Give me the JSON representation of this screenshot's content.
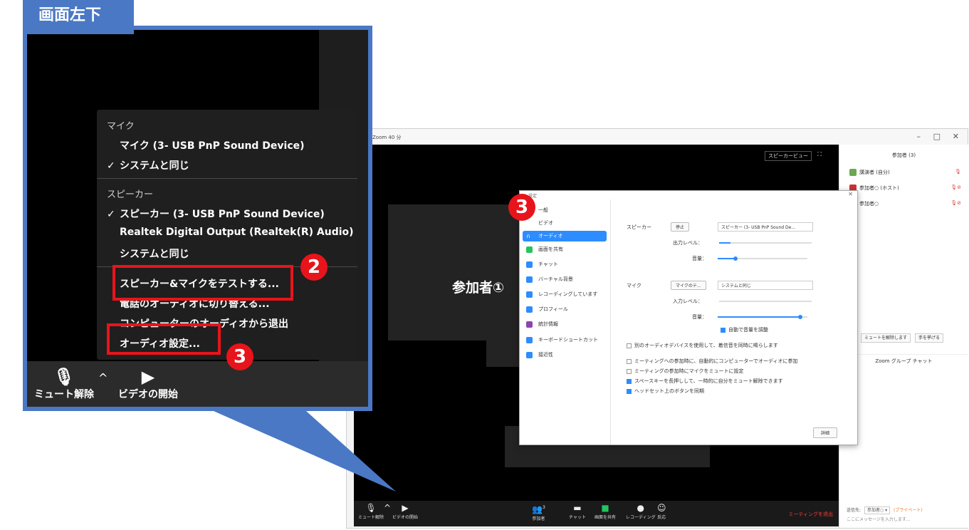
{
  "callout": {
    "label": "画面左下",
    "audio_menu": {
      "mic_header": "マイク",
      "mic_device": "マイク (3- USB PnP Sound Device)",
      "mic_same_as_system": "システムと同じ",
      "mic_same_checked": "✓",
      "speaker_header": "スピーカー",
      "speaker_device": "スピーカー (3- USB PnP Sound Device)",
      "speaker_device_checked": "✓",
      "speaker_realtek": "Realtek Digital Output (Realtek(R) Audio)",
      "speaker_same_as_system": "システムと同じ",
      "test_speaker_mic": "スピーカー&マイクをテストする...",
      "switch_to_phone": "電話のオーディオに切り替える...",
      "leave_computer_audio": "コンピューターのオーディオから退出",
      "audio_settings": "オーディオ設定..."
    },
    "toolbar": {
      "unmute": "ミュート解除",
      "start_video": "ビデオの開始",
      "caret": "^"
    },
    "badge_2": "2",
    "badge_3": "3"
  },
  "zoom": {
    "title": "Zoom 40 分",
    "window_controls": [
      "–",
      "□",
      "✕"
    ],
    "speaker_view": "スピーカービュー",
    "participant_name": "参加者①",
    "toolbar": {
      "unmute": "ミュート解除",
      "start_video": "ビデオの開始",
      "participants": "参加者",
      "participants_count": "3",
      "chat": "チャット",
      "share_screen": "画面を共有",
      "record": "レコーディング",
      "reactions": "反応",
      "end_meeting": "ミーティングを退出"
    },
    "participants_panel": {
      "header": "参加者 (3)",
      "items": [
        {
          "name": "講演者 (自分)",
          "color": "#6aa84f"
        },
        {
          "name": "参加者○ (ホスト)",
          "color": "#cc3333"
        },
        {
          "name": "参加者○",
          "color": "#999999"
        }
      ],
      "unmute_all": "ミュートを解除します",
      "raise_hand": "手を挙げる",
      "group_chat": "Zoom グループ チャット",
      "send_to_label": "送信先:",
      "send_to_value": "参加者○ ▾",
      "private_label": "(プライベート)",
      "message_placeholder": "ここにメッセージを入力します..."
    },
    "settings": {
      "title": "設定",
      "nav": [
        "一般",
        "ビデオ",
        "オーディオ",
        "画面を共有",
        "チャット",
        "バーチャル背景",
        "レコーディングしています",
        "プロフィール",
        "統計情報",
        "キーボードショートカット",
        "接近性"
      ],
      "active_nav_index": 2,
      "speaker_label": "スピーカー",
      "stop_button": "停止",
      "speaker_select": "スピーカー (3- USB PnP Sound De...",
      "output_level_label": "出力レベル：",
      "volume_label": "音量：",
      "speaker_volume": 0.2,
      "mic_label": "マイク",
      "mic_test_button": "マイクのテ...",
      "mic_select": "システムと同じ",
      "input_level_label": "入力レベル：",
      "mic_volume": 0.92,
      "auto_adjust": "自動で音量を調整",
      "separate_device": "別のオーディオデバイスを使用して、着信音を同時に鳴らします",
      "auto_join": "ミーティングへの参加時に、自動的にコンピューターでオーディオに参加",
      "mute_on_join": "ミーティングの参加時にマイクをミュートに設定",
      "space_unmute": "スペースキーを長押しして、一時的に自分をミュート解除できます",
      "sync_headset": "ヘッドセット上のボタンを同期",
      "advanced_button": "詳細",
      "badge_3": "3"
    }
  }
}
